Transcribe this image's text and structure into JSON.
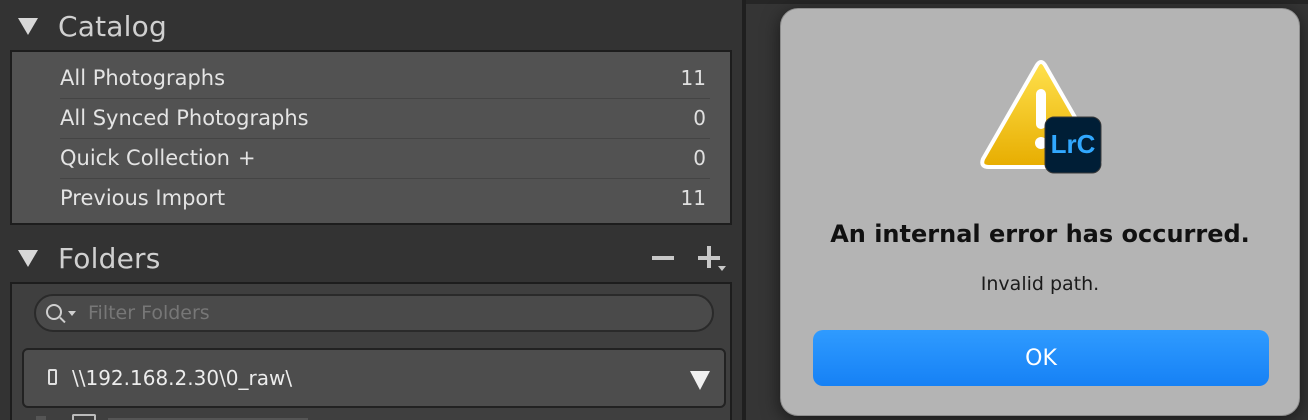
{
  "catalog": {
    "title": "Catalog",
    "items": [
      {
        "label": "All Photographs",
        "count": "11",
        "suffix": ""
      },
      {
        "label": "All Synced Photographs",
        "count": "0",
        "suffix": ""
      },
      {
        "label": "Quick Collection",
        "count": "0",
        "suffix": "+"
      },
      {
        "label": "Previous Import",
        "count": "11",
        "suffix": ""
      }
    ]
  },
  "folders": {
    "title": "Folders",
    "filter_placeholder": "Filter Folders",
    "volume_path": "\\\\192.168.2.30\\0_raw\\"
  },
  "dialog": {
    "app_badge": "LrC",
    "title": "An internal error has occurred.",
    "message": "Invalid path.",
    "ok_label": "OK"
  },
  "colors": {
    "dialog_bg": "#b4b4b4",
    "ok_button": "#1e8cfa",
    "badge_bg": "#001e36",
    "badge_text": "#31a8ff",
    "warning_yellow": "#f5c400"
  }
}
